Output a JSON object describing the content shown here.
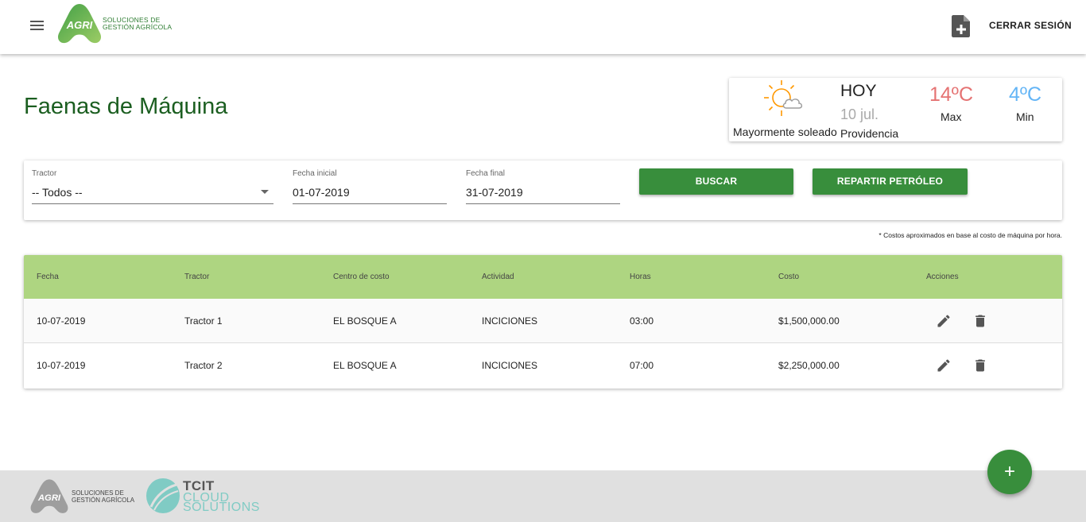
{
  "header": {
    "logo_text": "SOLUCIONES DE\nGESTIÓN AGRÍCOLA",
    "logo_badge": "AGRI",
    "logout_label": "CERRAR SESIÓN",
    "menu_icon": "hamburger-menu-icon",
    "new_doc_icon": "note-add-icon"
  },
  "page": {
    "title": "Faenas de Máquina"
  },
  "weather": {
    "description": "Mayormente soleado",
    "day": "HOY",
    "date": "10 jul.",
    "city": "Providencia",
    "max_temp": "14ºC",
    "min_temp": "4ºC",
    "max_label": "Max",
    "min_label": "Min",
    "icon": "partly-sunny-icon"
  },
  "filters": {
    "tractor": {
      "label": "Tractor",
      "value": "-- Todos --"
    },
    "start_date": {
      "label": "Fecha inicial",
      "value": "01-07-2019"
    },
    "end_date": {
      "label": "Fecha final",
      "value": "31-07-2019"
    },
    "search_label": "BUSCAR",
    "distribute_label": "REPARTIR PETRÓLEO"
  },
  "note": "* Costos aproximados en base al costo de máquina por hora.",
  "table": {
    "headers": [
      "Fecha",
      "Tractor",
      "Centro de costo",
      "Actividad",
      "Horas",
      "Costo",
      "Acciones"
    ],
    "rows": [
      [
        "10-07-2019",
        "Tractor 1",
        "EL BOSQUE A",
        "INCICIONES",
        "03:00",
        "$1,500,000.00"
      ],
      [
        "10-07-2019",
        "Tractor 2",
        "EL BOSQUE A",
        "INCICIONES",
        "07:00",
        "$2,250,000.00"
      ]
    ]
  },
  "footer": {
    "agri_badge": "AGRI",
    "agri_text": "SOLUCIONES DE\nGESTIÓN AGRÍCOLA",
    "tcit_title": "TCIT",
    "tcit_line1": "CLOUD",
    "tcit_line2": "SOLUTIONS"
  },
  "fab": {
    "label": "+"
  },
  "colors": {
    "primary": "#388e3c",
    "title": "#1b5e20",
    "table_header": "#aed581",
    "max_temp": "#e57373",
    "min_temp": "#64b5f6"
  }
}
